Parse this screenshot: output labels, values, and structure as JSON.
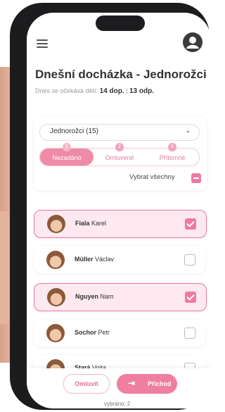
{
  "header": {
    "title": "Dnešní docházka - Jednorožci",
    "expected_label": "Dnes se očekává dětí:",
    "expected_adults": "14 dop.",
    "separator": "|",
    "expected_afternoon": "13 odp."
  },
  "group_select": {
    "value": "Jednorožci (15)"
  },
  "tabs": [
    {
      "label": "Nezadáno",
      "count": "5",
      "active": true
    },
    {
      "label": "Omluvené",
      "count": "2",
      "active": false
    },
    {
      "label": "Přítomné",
      "count": "8",
      "active": false
    }
  ],
  "select_all_label": "Vybrat všechny",
  "children": [
    {
      "surname": "Fiala",
      "first": "Karel",
      "checked": true
    },
    {
      "surname": "Müller",
      "first": "Václav",
      "checked": false
    },
    {
      "surname": "Nguyen",
      "first": "Nam",
      "checked": true
    },
    {
      "surname": "Sochor",
      "first": "Petr",
      "checked": false
    },
    {
      "surname": "Stará",
      "first": "Vojta",
      "checked": false
    }
  ],
  "footer": {
    "excuse_label": "Omluvit",
    "arrival_label": "Příchod",
    "selected_text": "vybráno: 2"
  },
  "colors": {
    "accent": "#ef7aa0",
    "accent_light": "#fde9ef"
  }
}
